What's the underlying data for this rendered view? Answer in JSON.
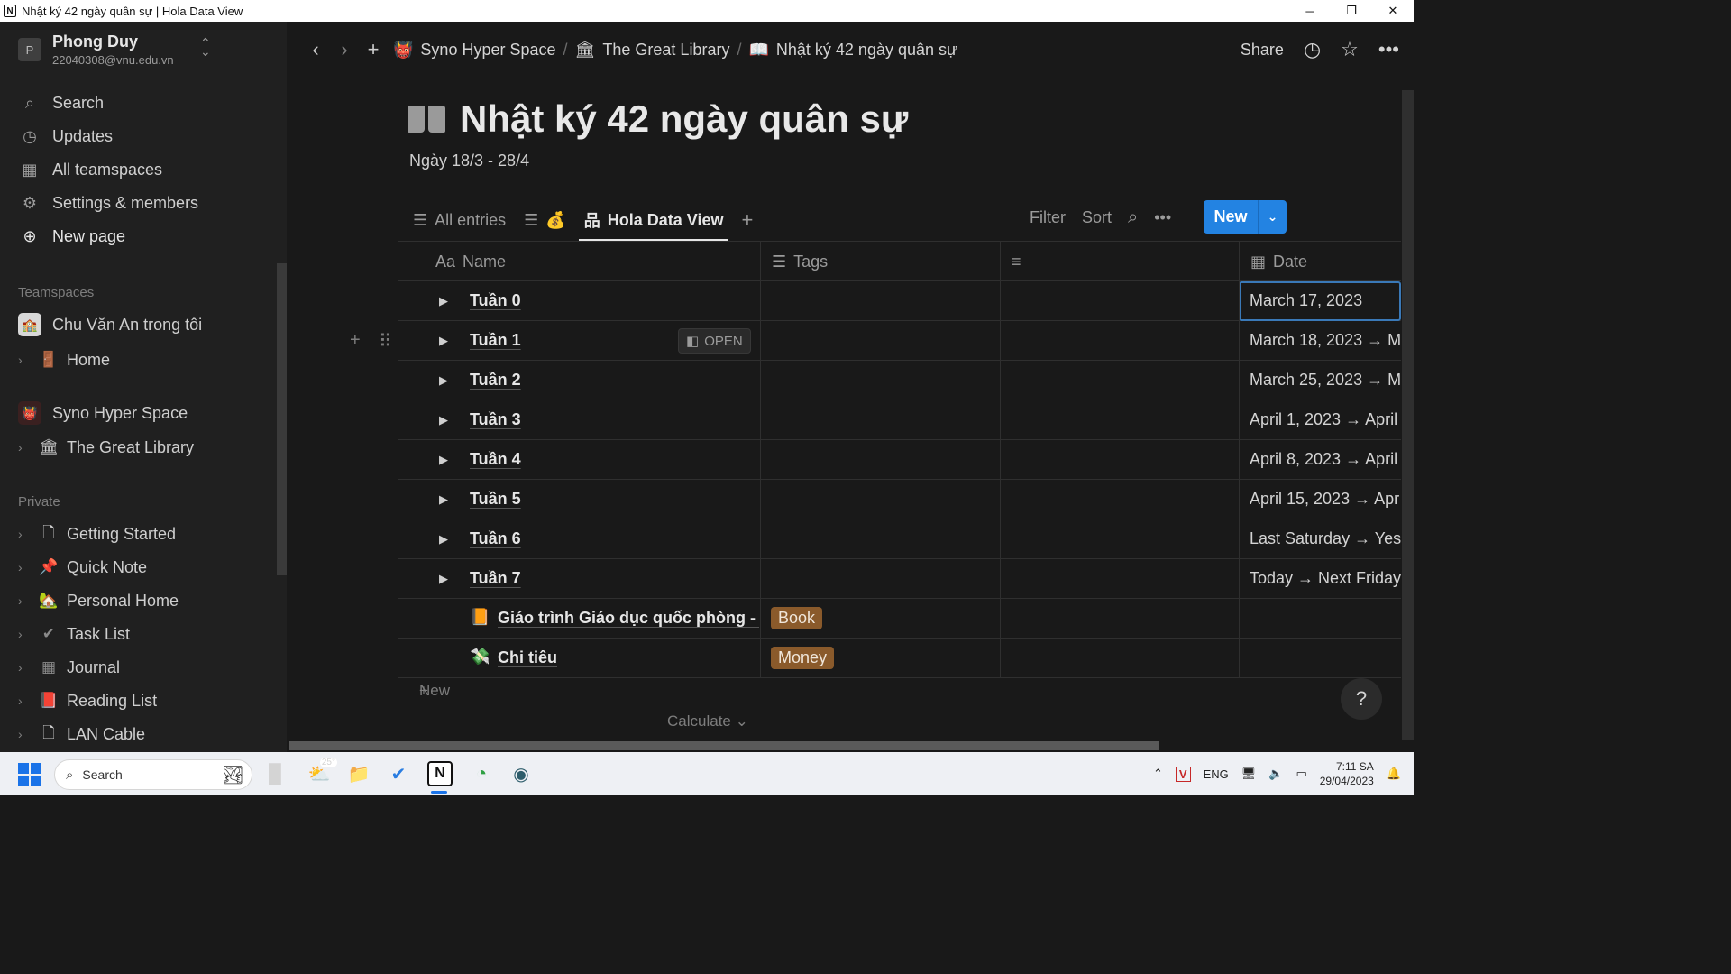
{
  "window": {
    "title": "Nhật ký 42 ngày quân sự | Hola Data View",
    "app_icon": "N"
  },
  "sidebar": {
    "workspace": {
      "avatar": "P",
      "name": "Phong Duy",
      "email": "22040308@vnu.edu.vn"
    },
    "nav": [
      {
        "label": "Search",
        "icon": "search-icon"
      },
      {
        "label": "Updates",
        "icon": "clock-icon"
      },
      {
        "label": "All teamspaces",
        "icon": "building-icon"
      },
      {
        "label": "Settings & members",
        "icon": "gear-icon"
      },
      {
        "label": "New page",
        "icon": "plus-circle-icon"
      }
    ],
    "teamspaces_label": "Teamspaces",
    "teamspace1": {
      "name": "Chu Văn An trong tôi",
      "child": "Home"
    },
    "teamspace2": {
      "name": "Syno Hyper Space",
      "child": "The Great Library"
    },
    "private_label": "Private",
    "private_items": [
      {
        "label": "Getting Started",
        "icon": "📄"
      },
      {
        "label": "Quick Note",
        "icon": "📌"
      },
      {
        "label": "Personal Home",
        "icon": "🏡"
      },
      {
        "label": "Task List",
        "icon": "✔"
      },
      {
        "label": "Journal",
        "icon": "▦"
      },
      {
        "label": "Reading List",
        "icon": "📕"
      },
      {
        "label": "LAN Cable",
        "icon": "📄"
      }
    ]
  },
  "breadcrumb": {
    "items": [
      "Syno Hyper Space",
      "The Great Library",
      "Nhật ký 42 ngày quân sự"
    ]
  },
  "topbar": {
    "share": "Share"
  },
  "page": {
    "title": "Nhật ký 42 ngày quân sự",
    "subtitle": "Ngày 18/3 - 28/4"
  },
  "views": {
    "tabs": [
      {
        "label": "All entries",
        "icon": "list-icon"
      },
      {
        "label": "",
        "icon": "money-bag-icon"
      },
      {
        "label": "Hola Data View",
        "icon": "hierarchy-icon",
        "active": true
      }
    ],
    "filter": "Filter",
    "sort": "Sort",
    "new_label": "New"
  },
  "table": {
    "columns": [
      {
        "label": "Name",
        "prefix": "Aa"
      },
      {
        "label": "Tags"
      },
      {
        "label": ""
      },
      {
        "label": "Date"
      }
    ],
    "rows": [
      {
        "name": "Tuần 0",
        "date": "March 17, 2023"
      },
      {
        "name": "Tuần 1",
        "date": "March 18, 2023 → M",
        "open": "OPEN"
      },
      {
        "name": "Tuần 2",
        "date": "March 25, 2023 → M"
      },
      {
        "name": "Tuần 3",
        "date": "April 1, 2023 → April"
      },
      {
        "name": "Tuần 4",
        "date": "April 8, 2023 → April"
      },
      {
        "name": "Tuần 5",
        "date": "April 15, 2023 → Apr"
      },
      {
        "name": "Tuần 6",
        "date": "Last Saturday → Yest"
      },
      {
        "name": "Tuần 7",
        "date": "Today → Next Friday"
      },
      {
        "name": "Giáo trình Giáo dục quốc phòng - A",
        "tag": "Book",
        "tag_color": "#8a5a2b",
        "icon": "📙"
      },
      {
        "name": "Chi tiêu",
        "tag": "Money",
        "tag_color": "#8a5a2b",
        "icon": "💸"
      }
    ],
    "add_new": "New",
    "calculate": "Calculate"
  },
  "help": "?",
  "taskbar": {
    "search": "Search",
    "weather": "25°",
    "lang": "ENG",
    "time": "7:11 SA",
    "date": "29/04/2023"
  },
  "colors": {
    "accent": "#2383e2",
    "bg": "#191919",
    "sidebar": "#202020",
    "tag": "#8a5a2b"
  }
}
